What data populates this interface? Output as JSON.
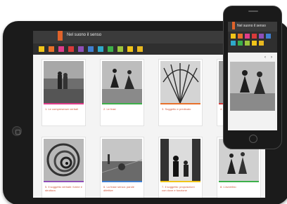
{
  "app": {
    "title": "Nel suono il senso"
  },
  "tag_colors": [
    "#f0c419",
    "#e8702a",
    "#e03c8a",
    "#d83a3a",
    "#8e4fb8",
    "#3f7fd0",
    "#2fa9c9",
    "#3cb04a",
    "#9bc53d",
    "#f0c419",
    "#e8b820"
  ],
  "cards": [
    {
      "caption": "1. Le compresenze verbali",
      "strip": "#e03c8a"
    },
    {
      "caption": "2. Le frasi",
      "strip": "#3cb04a"
    },
    {
      "caption": "3. Soggetto e predicato",
      "strip": "#e8702a"
    },
    {
      "caption": "4.",
      "strip": "#d83a3a"
    },
    {
      "caption": "5. Il soggetto verbale: forme e struttura",
      "strip": "#8e4fb8"
    },
    {
      "caption": "6. La frase senza: parole difettive",
      "strip": "#3f7fd0"
    },
    {
      "caption": "7. Il soggetto: proposizioni con dove e funzione",
      "strip": "#f0c419"
    },
    {
      "caption": "8. L'avverbio",
      "strip": "#3cb04a"
    }
  ],
  "phone": {
    "title": "Nel suono il senso",
    "prev_label": "‹",
    "next_label": "›"
  }
}
